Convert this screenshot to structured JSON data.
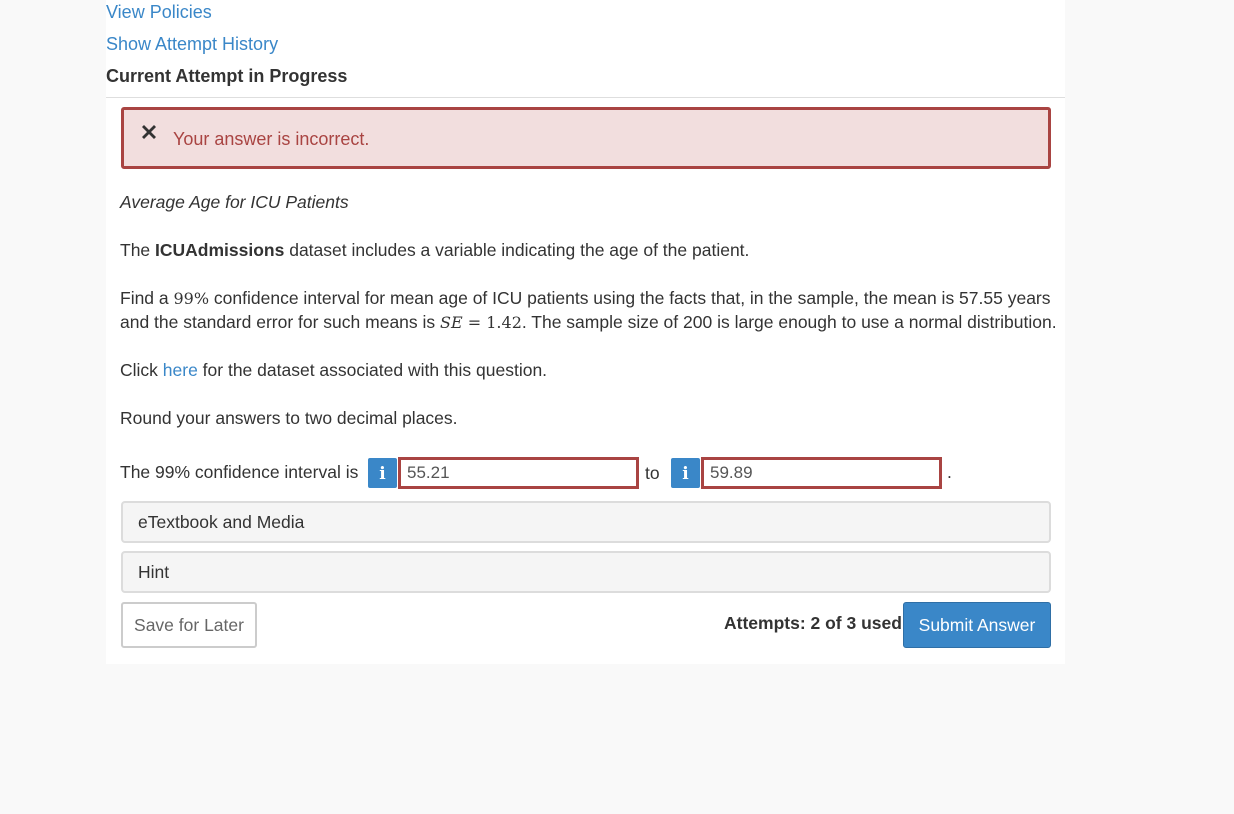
{
  "links": {
    "view_policies": "View Policies",
    "show_attempt_history": "Show Attempt History"
  },
  "current_attempt_label": "Current Attempt in Progress",
  "alert": {
    "icon": "x-icon",
    "message": "Your answer is incorrect.",
    "color": "#a94442"
  },
  "question": {
    "title": "Average Age for ICU Patients",
    "p1_before": "The ",
    "p1_bold": "ICUAdmissions",
    "p1_after": " dataset includes a variable indicating the age of the patient.",
    "p2_a1": "Find a ",
    "p2_math_pct": "99%",
    "p2_a2": " confidence interval for mean age of ICU patients using the facts that, in the sample, the mean is 57.55 years",
    "p2_b1": "and the standard error for such means is ",
    "p2_math_se": "SE",
    "p2_math_eq": " = 1.42",
    "p2_b2": ". The sample size of 200 is large enough to use a normal distribution.",
    "p3_before": "Click ",
    "p3_link": "here",
    "p3_after": " for the dataset associated with this question.",
    "p4": "Round your answers to two decimal places."
  },
  "interval": {
    "label": "The 99% confidence interval is",
    "lower_value": "55.21",
    "to_label": "to",
    "upper_value": "59.89",
    "period": ".",
    "info_glyph": "i"
  },
  "sections": {
    "etextbook": "eTextbook and Media",
    "hint": "Hint"
  },
  "footer": {
    "save_label": "Save for Later",
    "attempts": "Attempts: 2 of 3 used",
    "submit_label": "Submit Answer"
  },
  "colors": {
    "accent": "#3a87c8",
    "error": "#a94442",
    "error_bg": "#f2dede"
  }
}
